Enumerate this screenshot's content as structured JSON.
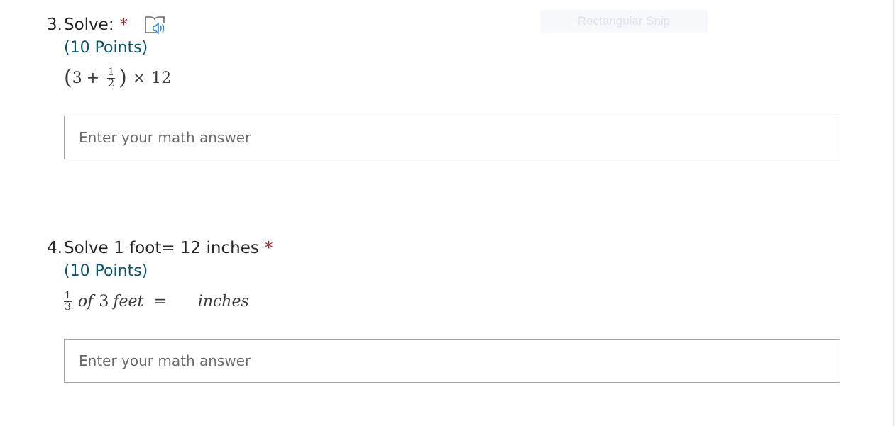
{
  "snip_label": "Rectangular Snip",
  "colors": {
    "required": "#a4262c",
    "points": "#0b556a",
    "reader_icon": "#2b88d8"
  },
  "questions": [
    {
      "number": "3.",
      "title": "Solve:",
      "required_mark": "*",
      "reader_icon": "immersive-reader-icon",
      "points": "(10 Points)",
      "expr": {
        "open": "(",
        "a": "3",
        "plus": "+",
        "num": "1",
        "den": "2",
        "close": ")",
        "times": "×",
        "b": "12"
      },
      "answer_placeholder": "Enter your math answer"
    },
    {
      "number": "4.",
      "title": "Solve 1 foot= 12 inches",
      "required_mark": "*",
      "points": "(10 Points)",
      "expr": {
        "num": "1",
        "den": "3",
        "of": "of",
        "value": "3",
        "feet": "feet",
        "eq": "=",
        "inches": "inches"
      },
      "answer_placeholder": "Enter your math answer"
    }
  ]
}
